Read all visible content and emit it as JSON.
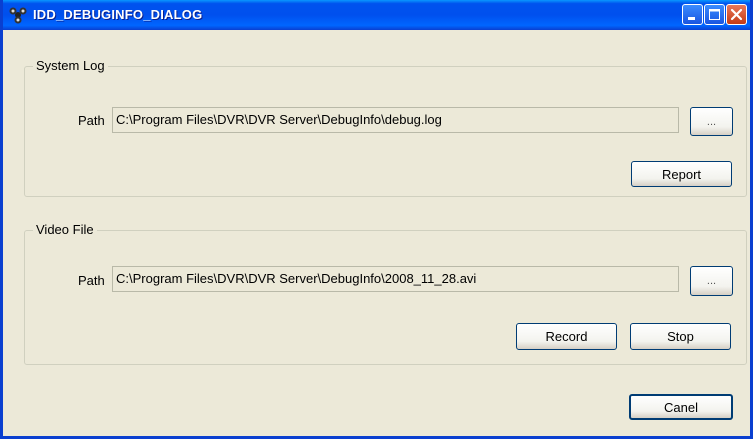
{
  "window": {
    "title": "IDD_DEBUGINFO_DIALOG",
    "app_icon": "dvr-app-icon",
    "controls": {
      "minimize": "minimize-icon",
      "maximize": "maximize-icon",
      "close": "close-icon"
    }
  },
  "system_log": {
    "group_label": "System Log",
    "path_label": "Path",
    "path_value": "C:\\Program Files\\DVR\\DVR Server\\DebugInfo\\debug.log",
    "browse_label": "...",
    "report_label": "Report"
  },
  "video_file": {
    "group_label": "Video File",
    "path_label": "Path",
    "path_value": "C:\\Program Files\\DVR\\DVR Server\\DebugInfo\\2008_11_28.avi",
    "browse_label": "...",
    "record_label": "Record",
    "stop_label": "Stop"
  },
  "footer": {
    "cancel_label": "Canel"
  },
  "colors": {
    "titlebar": "#0053ee",
    "dialog_bg": "#ece9d8",
    "button_border": "#003c74"
  }
}
